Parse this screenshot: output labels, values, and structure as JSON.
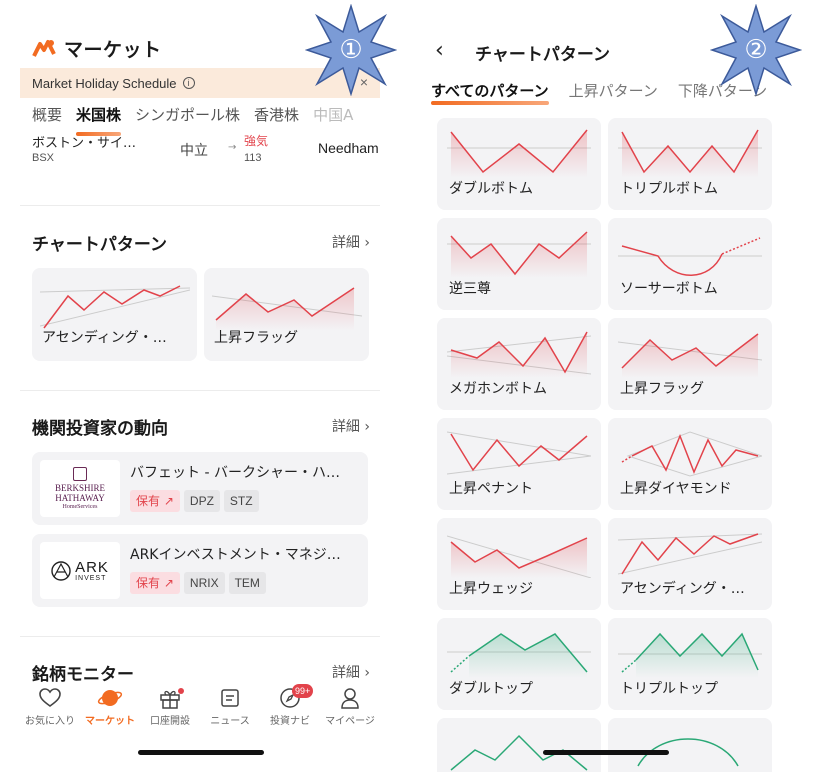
{
  "left": {
    "header_title": "マーケット",
    "holiday_banner": "Market Holiday Schedule",
    "market_tabs": [
      "概要",
      "米国株",
      "シンガポール株",
      "香港株",
      "中国A"
    ],
    "active_tab_index": 1,
    "stock_row": {
      "name": "ボストン・サイ…",
      "symbol": "BSX",
      "rating": "中立",
      "new_rating": "強気",
      "number": "113",
      "firm": "Needham"
    },
    "chart_section": {
      "title": "チャートパターン",
      "more": "詳細",
      "cards": [
        {
          "label": "アセンディング・…"
        },
        {
          "label": "上昇フラッグ"
        }
      ]
    },
    "institution_section": {
      "title": "機関投資家の動向",
      "more": "詳細",
      "items": [
        {
          "name": "バフェット - バークシャー・ハ…",
          "logo_line1": "BERKSHIRE",
          "logo_line2": "HATHAWAY",
          "logo_line3": "HomeServices",
          "hold": "保有",
          "tags": [
            "DPZ",
            "STZ"
          ]
        },
        {
          "name": "ARKインベストメント・マネジ…",
          "logo_line1": "ARK",
          "logo_line2": "INVEST",
          "hold": "保有",
          "tags": [
            "NRIX",
            "TEM"
          ]
        }
      ]
    },
    "monitor_section": {
      "title": "銘柄モニター",
      "more": "詳細"
    },
    "bottom_nav": [
      {
        "label": "お気に入り",
        "icon": "heart-icon"
      },
      {
        "label": "マーケット",
        "icon": "planet-icon"
      },
      {
        "label": "口座開設",
        "icon": "gift-icon"
      },
      {
        "label": "ニュース",
        "icon": "news-icon"
      },
      {
        "label": "投資ナビ",
        "icon": "compass-icon",
        "badge": "99+"
      },
      {
        "label": "マイページ",
        "icon": "person-icon"
      }
    ]
  },
  "right": {
    "title": "チャートパターン",
    "tabs": [
      "すべてのパターン",
      "上昇パターン",
      "下降パターン"
    ],
    "patterns": [
      {
        "label": "ダブルボトム",
        "color": "red"
      },
      {
        "label": "トリプルボトム",
        "color": "red"
      },
      {
        "label": "逆三尊",
        "color": "red"
      },
      {
        "label": "ソーサーボトム",
        "color": "red"
      },
      {
        "label": "メガホンボトム",
        "color": "red"
      },
      {
        "label": "上昇フラッグ",
        "color": "red"
      },
      {
        "label": "上昇ペナント",
        "color": "red"
      },
      {
        "label": "上昇ダイヤモンド",
        "color": "red"
      },
      {
        "label": "上昇ウェッジ",
        "color": "red"
      },
      {
        "label": "アセンディング・…",
        "color": "red"
      },
      {
        "label": "ダブルトップ",
        "color": "green"
      },
      {
        "label": "トリプルトップ",
        "color": "green"
      }
    ]
  },
  "badges": [
    "①",
    "②"
  ],
  "colors": {
    "accent": "#f26b21",
    "up": "#e2434b",
    "down": "#2aa876",
    "badge_fill": "#7b9bd6"
  }
}
